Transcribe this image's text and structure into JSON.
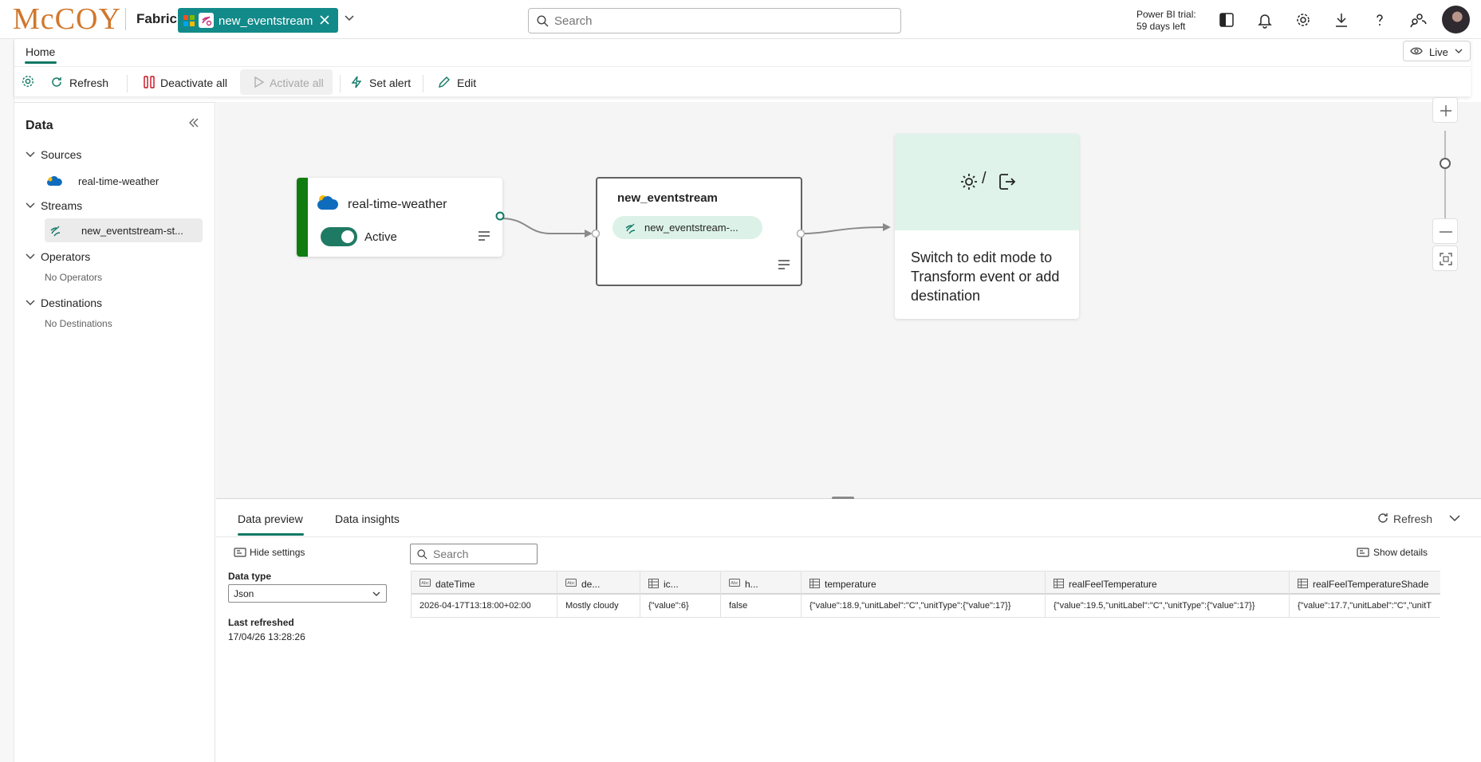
{
  "brand": {
    "logo_text": "McCOY",
    "product": "Fabric"
  },
  "open_tab": {
    "label": "new_eventstream"
  },
  "search": {
    "placeholder": "Search"
  },
  "trial": {
    "line1": "Power BI trial:",
    "line2": "59 days left"
  },
  "top_icons": [
    "panel-icon",
    "bell-icon",
    "gear-icon",
    "download-icon",
    "help-icon",
    "share-people-icon"
  ],
  "ribbon": {
    "tab": "Home",
    "live_label": "Live",
    "buttons": {
      "refresh": "Refresh",
      "deactivate_all": "Deactivate all",
      "activate_all": "Activate all",
      "set_alert": "Set alert",
      "edit": "Edit"
    }
  },
  "data_panel": {
    "title": "Data",
    "sources": {
      "label": "Sources",
      "items": [
        "real-time-weather"
      ]
    },
    "streams": {
      "label": "Streams",
      "items": [
        "new_eventstream-st..."
      ]
    },
    "operators": {
      "label": "Operators",
      "empty": "No Operators"
    },
    "destinations": {
      "label": "Destinations",
      "empty": "No Destinations"
    }
  },
  "canvas": {
    "source_node": {
      "name": "real-time-weather",
      "status": "Active",
      "active": true
    },
    "stream_node": {
      "name": "new_eventstream",
      "pill": "new_eventstream-..."
    },
    "destination_node": {
      "separator": "/",
      "message": "Switch to edit mode to Transform event or add destination"
    }
  },
  "preview": {
    "tabs": [
      "Data preview",
      "Data insights"
    ],
    "active_tab": "Data preview",
    "refresh_label": "Refresh",
    "hide_settings": "Hide settings",
    "data_type_label": "Data type",
    "data_type_value": "Json",
    "last_refreshed_label": "Last refreshed",
    "last_refreshed_value": "17/04/26 13:28:26",
    "search_placeholder": "Search",
    "show_details": "Show details",
    "columns": [
      {
        "name": "dateTime",
        "type": "string"
      },
      {
        "name": "de...",
        "type": "string"
      },
      {
        "name": "ic...",
        "type": "record"
      },
      {
        "name": "h...",
        "type": "string"
      },
      {
        "name": "temperature",
        "type": "record"
      },
      {
        "name": "realFeelTemperature",
        "type": "record"
      },
      {
        "name": "realFeelTemperatureShade",
        "type": "record"
      }
    ],
    "rows": [
      [
        "2026-04-17T13:18:00+02:00",
        "Mostly cloudy",
        "{\"value\":6}",
        "false",
        "{\"value\":18.9,\"unitLabel\":\"C\",\"unitType\":{\"value\":17}}",
        "{\"value\":19.5,\"unitLabel\":\"C\",\"unitType\":{\"value\":17}}",
        "{\"value\":17.7,\"unitLabel\":\"C\",\"unitT"
      ]
    ]
  },
  "colors": {
    "accent": "#117865",
    "tab_teal": "#128a8a",
    "source_bar": "#107c10",
    "toggle_on": "#1f7a63",
    "dest_bg": "#dff3ea"
  }
}
